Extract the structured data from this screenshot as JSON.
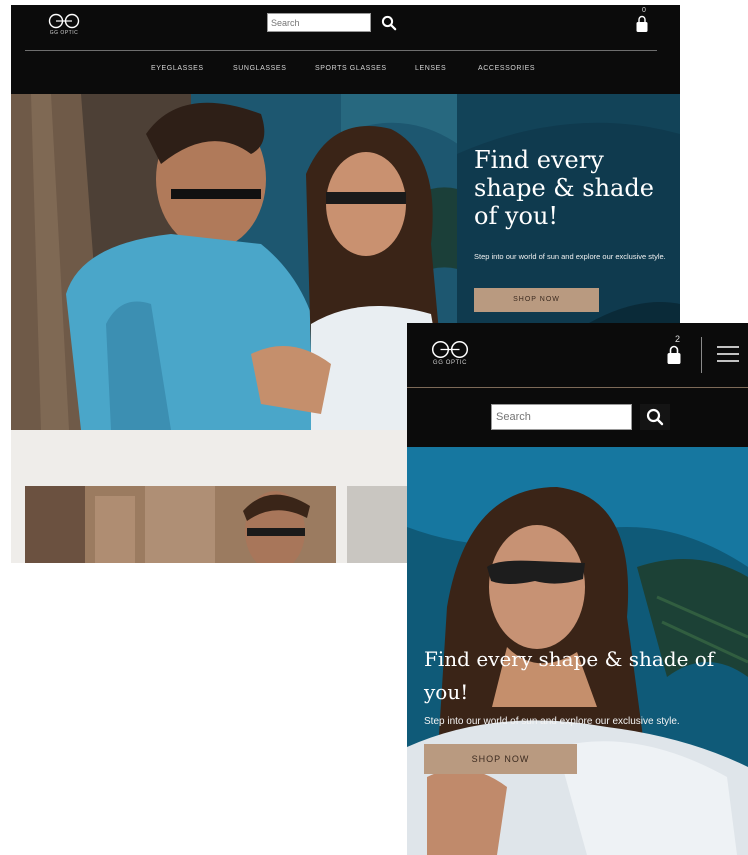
{
  "desktop": {
    "logo_text": "GG OPTIC",
    "search": {
      "placeholder": "Search"
    },
    "cart": {
      "count": "0"
    },
    "nav": [
      "EYEGLASSES",
      "SUNGLASSES",
      "SPORTS GLASSES",
      "LENSES",
      "ACCESSORIES"
    ],
    "hero": {
      "headline": "Find every shape & shade of you!",
      "subtext": "Step into our world of sun and explore our exclusive style.",
      "cta": "SHOP NOW"
    }
  },
  "mobile": {
    "logo_text": "GG OPTIC",
    "search": {
      "placeholder": "Search"
    },
    "cart": {
      "count": "2"
    },
    "hero": {
      "headline": "Find every shape & shade of you!",
      "subtext": "Step into our world of sun and explore our exclusive style.",
      "cta": "SHOP NOW"
    }
  },
  "colors": {
    "header_bg": "#0b0b0b",
    "accent": "#b99a80",
    "hero_teal": "#0f3f55",
    "band_bg": "#efedea"
  },
  "icons": [
    "logo-icon",
    "search-icon",
    "cart-icon",
    "menu-icon"
  ]
}
